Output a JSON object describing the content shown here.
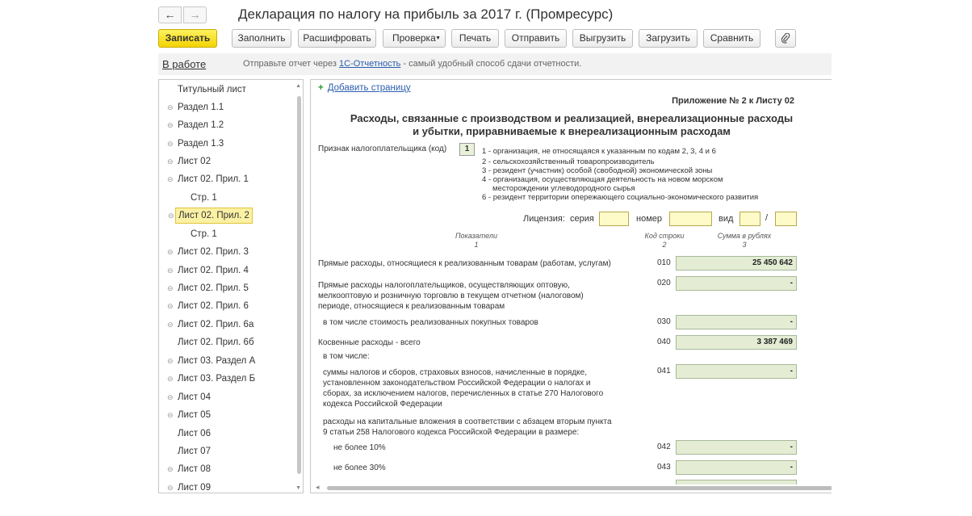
{
  "window": {
    "title": "Декларация по налогу на прибыль за 2017 г. (Промресурс)",
    "back_icon": "←",
    "forward_icon": "→"
  },
  "toolbar": {
    "save": "Записать",
    "fill": "Заполнить",
    "decode": "Расшифровать",
    "check": "Проверка",
    "print": "Печать",
    "send": "Отправить",
    "unload": "Выгрузить",
    "load": "Загрузить",
    "compare": "Сравнить",
    "attach_icon": "paperclip-icon"
  },
  "status": {
    "state": "В работе",
    "hint_prefix": "Отправьте отчет через ",
    "hint_link": "1С-Отчетность",
    "hint_suffix": " - самый удобный способ сдачи отчетности."
  },
  "tree": {
    "items": [
      {
        "label": "Титульный лист"
      },
      {
        "label": "Раздел 1.1"
      },
      {
        "label": "Раздел 1.2"
      },
      {
        "label": "Раздел 1.3"
      },
      {
        "label": "Лист 02"
      },
      {
        "label": "Лист 02. Прил. 1"
      },
      {
        "label": "Стр. 1"
      },
      {
        "label": "Лист 02. Прил. 2"
      },
      {
        "label": "Стр. 1"
      },
      {
        "label": "Лист 02. Прил. 3"
      },
      {
        "label": "Лист 02. Прил. 4"
      },
      {
        "label": "Лист 02. Прил. 5"
      },
      {
        "label": "Лист 02. Прил. 6"
      },
      {
        "label": "Лист 02. Прил. 6а"
      },
      {
        "label": "Лист 02. Прил. 6б"
      },
      {
        "label": "Лист 03. Раздел А"
      },
      {
        "label": "Лист 03. Раздел Б"
      },
      {
        "label": "Лист 04"
      },
      {
        "label": "Лист 05"
      },
      {
        "label": "Лист 06"
      },
      {
        "label": "Лист 07"
      },
      {
        "label": "Лист 08"
      },
      {
        "label": "Лист 09"
      }
    ],
    "selected": "Лист 02. Прил. 2"
  },
  "form": {
    "add_page": "Добавить страницу",
    "appendix": "Приложение № 2 к Листу 02",
    "title_line1": "Расходы, связанные с производством и реализацией, внереализационные расходы",
    "title_line2": "и убытки, приравниваемые к внереализационным расходам",
    "taxpayer_label": "Признак налогоплательщика (код)",
    "taxpayer_code": "1",
    "taxpayer_options": [
      "1 - организация, не относящаяся к указанным по кодам 2, 3, 4 и 6",
      "2 - сельскохозяйственный товаропроизводитель",
      "3 - резидент (участник) особой (свободной) экономической зоны",
      "4 - организация, осуществляющая деятельность на новом морском",
      "месторождении углеводородного сырья",
      "6 - резидент территории опережающего социально-экономического развития"
    ],
    "license": {
      "label": "Лицензия:",
      "series": "серия",
      "number": "номер",
      "kind": "вид",
      "slash": "/"
    },
    "columns": {
      "indicators": "Показатели",
      "indicators_num": "1",
      "code": "Код строки",
      "code_num": "2",
      "sum": "Сумма в рублях",
      "sum_num": "3"
    },
    "rows": {
      "r010_label": "Прямые расходы, относящиеся к реализованным товарам (работам, услугам)",
      "r010_code": "010",
      "r010_value": "25 450 642",
      "r020_label_1": "Прямые расходы налогоплательщиков, осуществляющих оптовую,",
      "r020_label_2": "мелкооптовую и розничную торговлю в текущем отчетном (налоговом)",
      "r020_label_3": "периоде, относящиеся к реализованным товарам",
      "r020_code": "020",
      "r020_value": "-",
      "r030_label": "в том числе стоимость реализованных покупных товаров",
      "r030_code": "030",
      "r030_value": "-",
      "r040_label": "Косвенные расходы - всего",
      "r040_code": "040",
      "r040_value": "3 387 469",
      "in_that_number": "в том числе:",
      "r041_label_1": "суммы налогов и сборов, страховых взносов, начисленные в порядке,",
      "r041_label_2": "установленном законодательством Российской Федерации о налогах и",
      "r041_label_3": "сборах, за исключением налогов, перечисленных в статье 270 Налогового",
      "r041_label_4": "кодекса Российской Федерации",
      "r041_code": "041",
      "r041_value": "-",
      "capital_label_1": "расходы на капитальные вложения в соответствии с абзацем вторым пункта",
      "capital_label_2": "9 статьи 258 Налогового кодекса Российской Федерации в размере:",
      "r042_label": "не более 10%",
      "r042_code": "042",
      "r042_value": "-",
      "r043_label": "не более 30%",
      "r043_code": "043",
      "r043_value": "-"
    }
  },
  "colors": {
    "primary_button": "#f3d300",
    "selection": "#fbf1a4",
    "field_green": "#e4edd4",
    "field_yellow": "#fffbc8",
    "link": "#2a5eb0"
  }
}
